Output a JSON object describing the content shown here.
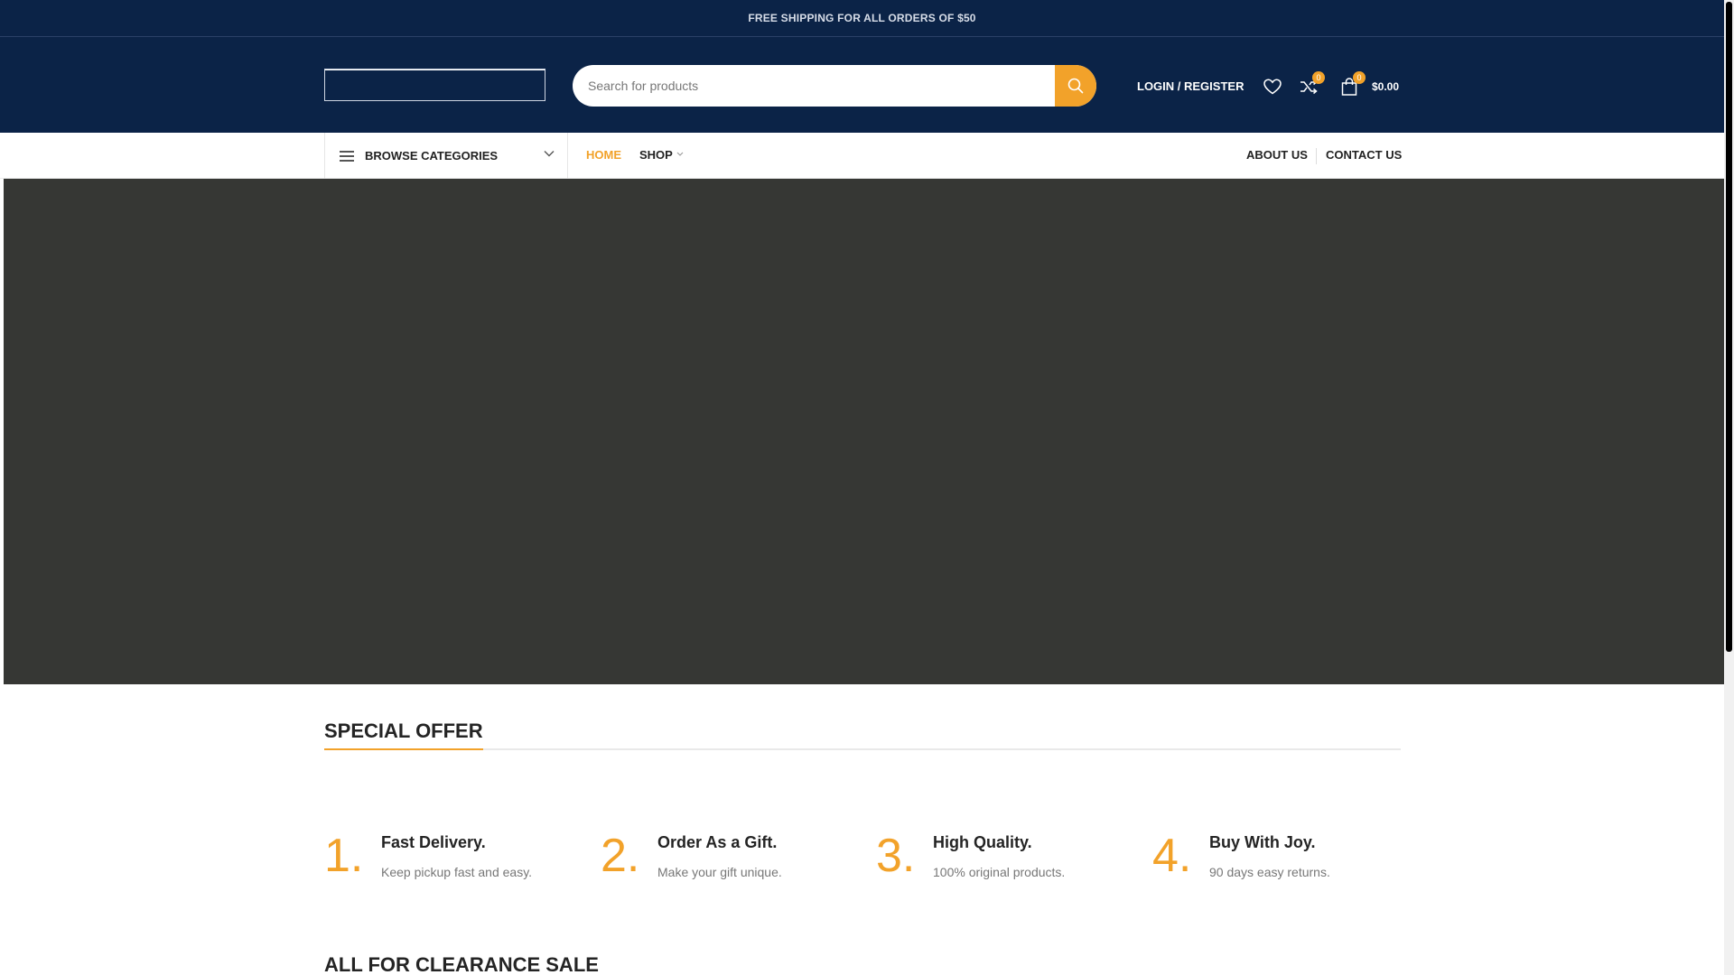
{
  "topbar": {
    "shipping_text": "FREE SHIPPING FOR ALL ORDERS OF $50"
  },
  "header": {
    "search": {
      "placeholder": "Search for products",
      "button_icon": "search-icon"
    },
    "login_label": "LOGIN / REGISTER",
    "wishlist_icon": "heart-icon",
    "compare": {
      "icon": "shuffle-icon",
      "count": "0"
    },
    "cart": {
      "icon": "shopping-bag-icon",
      "count": "0",
      "total": "$0.00"
    }
  },
  "nav": {
    "browse_label": "BROWSE CATEGORIES",
    "links": [
      {
        "label": "HOME",
        "active": true
      },
      {
        "label": "SHOP",
        "has_dropdown": true
      }
    ],
    "right_links": [
      {
        "label": "ABOUT US"
      },
      {
        "label": "CONTACT US"
      }
    ]
  },
  "sections": {
    "special_offer": "SPECIAL OFFER",
    "clearance": "ALL FOR CLEARANCE SALE"
  },
  "features": [
    {
      "num": "1.",
      "title": "Fast Delivery.",
      "desc": "Keep pickup fast and easy."
    },
    {
      "num": "2.",
      "title": "Order As a Gift.",
      "desc": "Make your gift unique."
    },
    {
      "num": "3.",
      "title": "High Quality.",
      "desc": "100% original products."
    },
    {
      "num": "4.",
      "title": "Buy With Joy.",
      "desc": "90 days easy returns."
    }
  ],
  "colors": {
    "header_bg": "#0b2347",
    "accent": "#f2a22a",
    "hero_bg": "#363734"
  }
}
